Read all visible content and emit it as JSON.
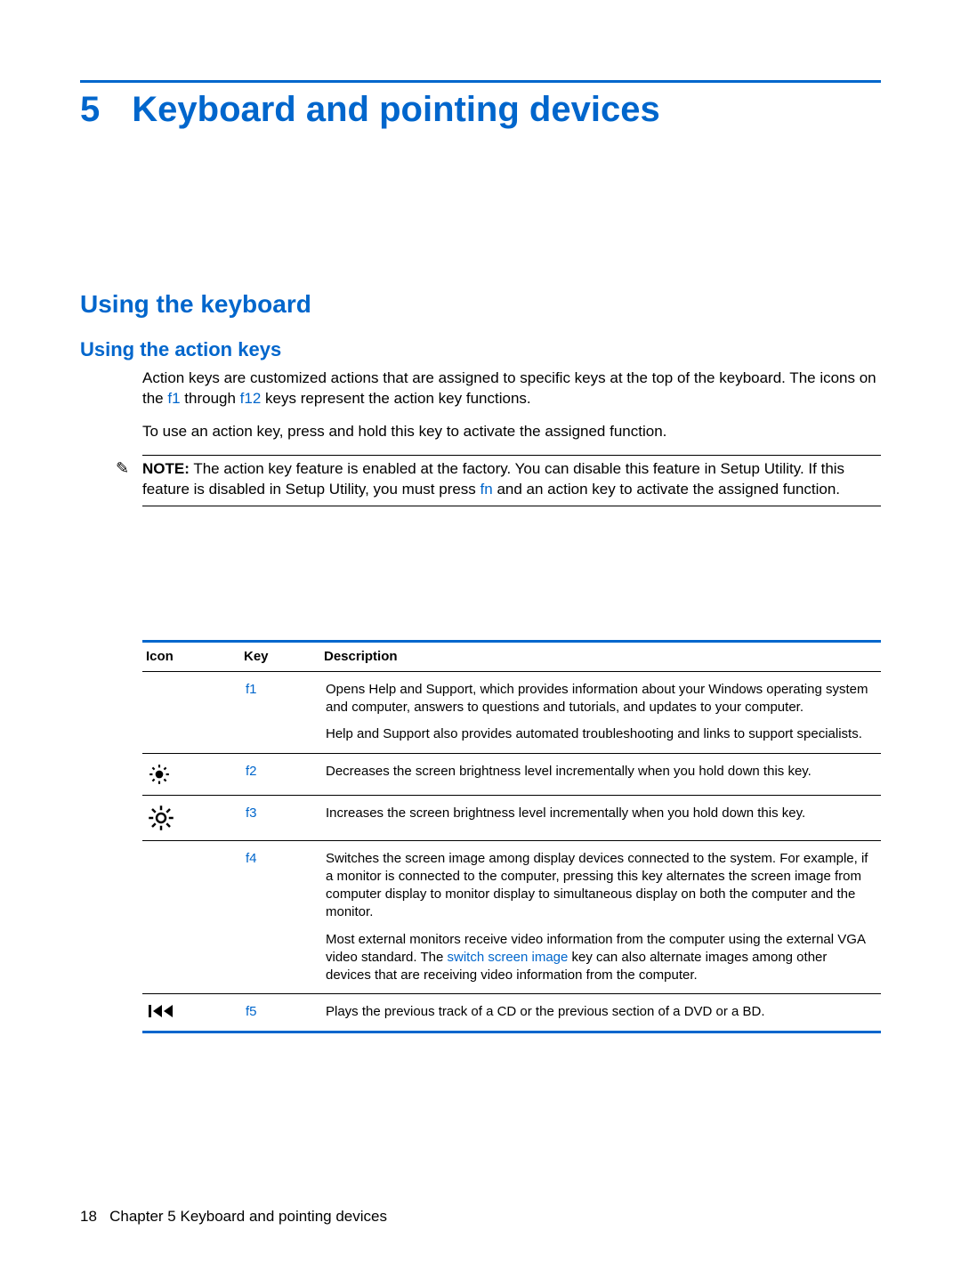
{
  "chapter": {
    "number": "5",
    "title": "Keyboard and pointing devices"
  },
  "h1": "Using the keyboard",
  "h2": "Using the action keys",
  "para1_a": "Action keys are customized actions that are assigned to specific keys at the top of the keyboard. The icons on the ",
  "para1_k1": "f1",
  "para1_mid": " through ",
  "para1_k2": "f12",
  "para1_b": " keys represent the action key functions.",
  "para2": "To use an action key, press and hold this key to activate the assigned function.",
  "note": {
    "label": "NOTE:",
    "a": "The action key feature is enabled at the factory. You can disable this feature in Setup Utility. If this feature is disabled in Setup Utility, you must press ",
    "fn": "fn",
    "b": " and an action key to activate the assigned function."
  },
  "table": {
    "headers": {
      "icon": "Icon",
      "key": "Key",
      "desc": "Description"
    },
    "rows": [
      {
        "icon": "",
        "key": "f1",
        "desc1": "Opens Help and Support, which provides information about your Windows operating system and computer, answers to questions and tutorials, and updates to your computer.",
        "desc2": "Help and Support also provides automated troubleshooting and links to support specialists."
      },
      {
        "icon": "brightness-down-icon",
        "key": "f2",
        "desc1": "Decreases the screen brightness level incrementally when you hold down this key."
      },
      {
        "icon": "brightness-up-icon",
        "key": "f3",
        "desc1": "Increases the screen brightness level incrementally when you hold down this key."
      },
      {
        "icon": "",
        "key": "f4",
        "desc1": "Switches the screen image among display devices connected to the system. For example, if a monitor is connected to the computer, pressing this key alternates the screen image from computer display to monitor display to simultaneous display on both the computer and the monitor.",
        "desc2a": "Most external monitors receive video information from the computer using the external VGA video standard. The ",
        "desc2key": "switch screen image",
        "desc2b": " key can also alternate images among other devices that are receiving video information from the computer."
      },
      {
        "icon": "previous-track-icon",
        "key": "f5",
        "desc1": "Plays the previous track of a CD or the previous section of a DVD or a BD."
      }
    ]
  },
  "footer": {
    "page": "18",
    "label": "Chapter 5   Keyboard and pointing devices"
  }
}
